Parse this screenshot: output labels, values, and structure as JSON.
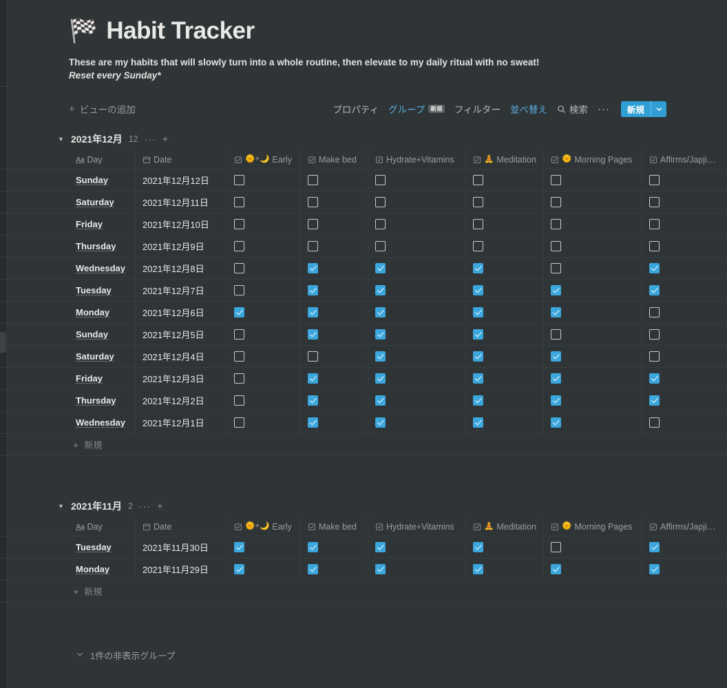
{
  "page": {
    "emoji": "🏁",
    "title": "Habit Tracker",
    "description_line1": "These are my habits that will slowly turn into a whole routine, then elevate to my daily ritual with no sweat!",
    "description_line2": "Reset every Sunday*"
  },
  "toolbar": {
    "add_view_plus": "+",
    "add_view_label": "ビューの追加",
    "properties_label": "プロパティ",
    "group_label": "グループ",
    "group_badge": "新規",
    "filter_label": "フィルター",
    "sort_label": "並べ替え",
    "search_label": "検索",
    "more_label": "···",
    "new_button_label": "新規",
    "new_button_caret": "⌄",
    "accent_color": "#2f9fd4",
    "link_color": "#5aaddc"
  },
  "columns": [
    {
      "key": "day",
      "label": "Day",
      "icon": "Aa",
      "icon_name": "text-property-icon"
    },
    {
      "key": "date",
      "label": "Date",
      "icon": "calendar",
      "icon_name": "calendar-icon"
    },
    {
      "key": "early",
      "label": "Early",
      "icon": "checkbox",
      "emoji": "🌞+🌙"
    },
    {
      "key": "makebed",
      "label": "Make bed",
      "icon": "checkbox",
      "emoji": ""
    },
    {
      "key": "hydrate",
      "label": "Hydrate+Vitamins",
      "icon": "checkbox",
      "emoji": ""
    },
    {
      "key": "meditation",
      "label": "Meditation",
      "icon": "checkbox",
      "emoji": "🧘"
    },
    {
      "key": "morning",
      "label": "Morning Pages",
      "icon": "checkbox",
      "emoji": "🌞"
    },
    {
      "key": "affirms",
      "label": "Affirms/Japji…",
      "icon": "checkbox",
      "emoji": ""
    }
  ],
  "groups": [
    {
      "caret": "▼",
      "name": "2021年12月",
      "count": "12",
      "dots": "···",
      "plus": "+",
      "rows": [
        {
          "day": "Sunday",
          "date": "2021年12月12日",
          "checks": [
            false,
            false,
            false,
            false,
            false,
            false
          ]
        },
        {
          "day": "Saturday",
          "date": "2021年12月11日",
          "checks": [
            false,
            false,
            false,
            false,
            false,
            false
          ]
        },
        {
          "day": "Friday",
          "date": "2021年12月10日",
          "checks": [
            false,
            false,
            false,
            false,
            false,
            false
          ]
        },
        {
          "day": "Thursday",
          "date": "2021年12月9日",
          "checks": [
            false,
            false,
            false,
            false,
            false,
            false
          ]
        },
        {
          "day": "Wednesday",
          "date": "2021年12月8日",
          "checks": [
            false,
            true,
            true,
            true,
            false,
            true
          ]
        },
        {
          "day": "Tuesday",
          "date": "2021年12月7日",
          "checks": [
            false,
            true,
            true,
            true,
            true,
            true
          ]
        },
        {
          "day": "Monday",
          "date": "2021年12月6日",
          "checks": [
            true,
            true,
            true,
            true,
            true,
            false
          ]
        },
        {
          "day": "Sunday",
          "date": "2021年12月5日",
          "checks": [
            false,
            true,
            true,
            true,
            false,
            false
          ]
        },
        {
          "day": "Saturday",
          "date": "2021年12月4日",
          "checks": [
            false,
            false,
            true,
            true,
            true,
            false
          ]
        },
        {
          "day": "Friday",
          "date": "2021年12月3日",
          "checks": [
            false,
            true,
            true,
            true,
            true,
            true
          ]
        },
        {
          "day": "Thursday",
          "date": "2021年12月2日",
          "checks": [
            false,
            true,
            true,
            true,
            true,
            true
          ]
        },
        {
          "day": "Wednesday",
          "date": "2021年12月1日",
          "checks": [
            false,
            true,
            true,
            true,
            true,
            false
          ]
        }
      ],
      "new_row_plus": "+",
      "new_row_label": "新規"
    },
    {
      "caret": "▼",
      "name": "2021年11月",
      "count": "2",
      "dots": "···",
      "plus": "+",
      "rows": [
        {
          "day": "Tuesday",
          "date": "2021年11月30日",
          "checks": [
            true,
            true,
            true,
            true,
            false,
            true
          ]
        },
        {
          "day": "Monday",
          "date": "2021年11月29日",
          "checks": [
            true,
            true,
            true,
            true,
            true,
            true
          ]
        }
      ],
      "new_row_plus": "+",
      "new_row_label": "新規"
    }
  ],
  "footer": {
    "hidden_groups_caret": "⌄",
    "hidden_groups_label": "1件の非表示グループ"
  }
}
